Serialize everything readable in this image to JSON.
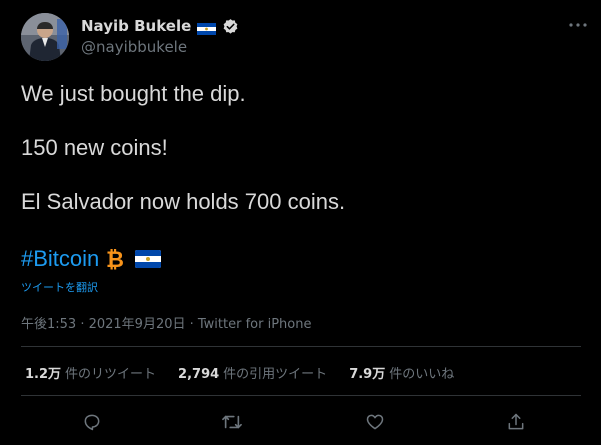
{
  "author": {
    "display_name": "Nayib Bukele",
    "handle": "@nayibbukele",
    "verified": true,
    "flag_icon": "el-salvador-flag-icon",
    "avatar_icon": "avatar"
  },
  "tweet": {
    "lines": [
      "We just bought the dip.",
      "150 new coins!",
      "El Salvador now holds 700 coins."
    ],
    "hashtag": "#Bitcoin",
    "translate_label": "ツイートを翻訳",
    "metadata": "午後1:53 · 2021年9月20日 · Twitter for iPhone"
  },
  "stats": [
    {
      "count": "1.2万",
      "label": "件のリツイート"
    },
    {
      "count": "2,794",
      "label": "件の引用ツイート"
    },
    {
      "count": "7.9万",
      "label": "件のいいね"
    }
  ],
  "actions": [
    "reply-icon",
    "retweet-icon",
    "like-icon",
    "share-icon"
  ],
  "colors": {
    "background": "#000000",
    "text": "#d9d9d9",
    "muted": "#6e767d",
    "link": "#1d9bf0",
    "divider": "#2f3336",
    "bitcoin": "#f7931a",
    "flag_blue": "#0047ab"
  }
}
